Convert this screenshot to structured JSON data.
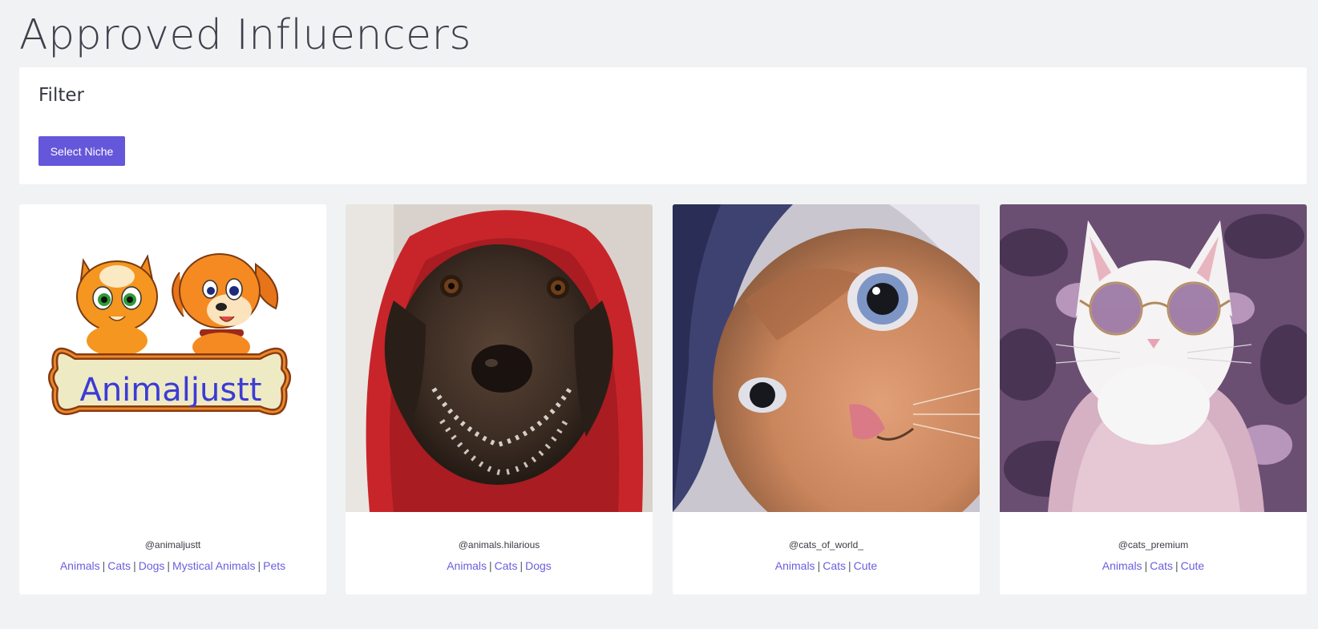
{
  "header": {
    "title": "Approved Influencers"
  },
  "filter": {
    "heading": "Filter",
    "select_niche_label": "Select Niche"
  },
  "influencers": [
    {
      "handle": "@animaljustt",
      "image_icon": "animaljustt-logo",
      "logo_text": "Animaljustt",
      "tags": [
        "Animals",
        "Cats",
        "Dogs",
        "Mystical Animals",
        "Pets"
      ]
    },
    {
      "handle": "@animals.hilarious",
      "image_icon": "dog-in-red-hood-photo",
      "tags": [
        "Animals",
        "Cats",
        "Dogs"
      ]
    },
    {
      "handle": "@cats_of_world_",
      "image_icon": "kitten-closeup-photo",
      "tags": [
        "Animals",
        "Cats",
        "Cute"
      ]
    },
    {
      "handle": "@cats_premium",
      "image_icon": "white-cat-sunglasses-photo",
      "tags": [
        "Animals",
        "Cats",
        "Cute"
      ]
    }
  ],
  "colors": {
    "accent": "#6557d9",
    "link": "#6b5fdc",
    "background": "#f1f2f4",
    "card": "#ffffff"
  }
}
